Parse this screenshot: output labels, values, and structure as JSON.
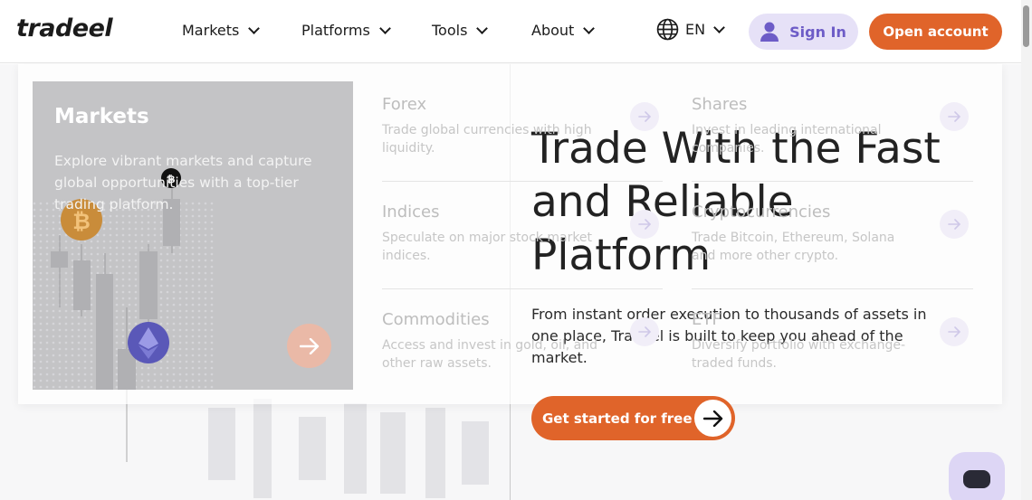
{
  "header": {
    "logo": "tradeel",
    "nav": [
      {
        "label": "Markets"
      },
      {
        "label": "Platforms"
      },
      {
        "label": "Tools"
      },
      {
        "label": "About"
      }
    ],
    "language": "EN",
    "sign_in": "Sign In",
    "open_account": "Open account"
  },
  "hero": {
    "title": "Trade With the Fast and Reliable Platform",
    "subtitle": "From instant order execution to thousands of assets in one place, Tradeel is built to keep you ahead of the market.",
    "cta": "Get started for free"
  },
  "menu": {
    "card": {
      "title": "Markets",
      "description": "Explore vibrant markets and capture global opportunities with a top-tier trading platform."
    },
    "items": [
      {
        "title": "Forex",
        "description": "Trade global currencies with high liquidity."
      },
      {
        "title": "Shares",
        "description": "Invest in leading international companies."
      },
      {
        "title": "Indices",
        "description": "Speculate on major stock market indices."
      },
      {
        "title": "Cryptocurrencies",
        "description": "Trade Bitcoin, Ethereum, Solana and more other crypto."
      },
      {
        "title": "Commodities",
        "description": "Access and invest in gold, oil, and other raw assets."
      },
      {
        "title": "ETF",
        "description": "Diversify portfolio with exchange-traded funds."
      }
    ]
  },
  "colors": {
    "accent": "#e0642a",
    "signin_bg": "#e6e1f7",
    "signin_text": "#6d5cc7"
  }
}
